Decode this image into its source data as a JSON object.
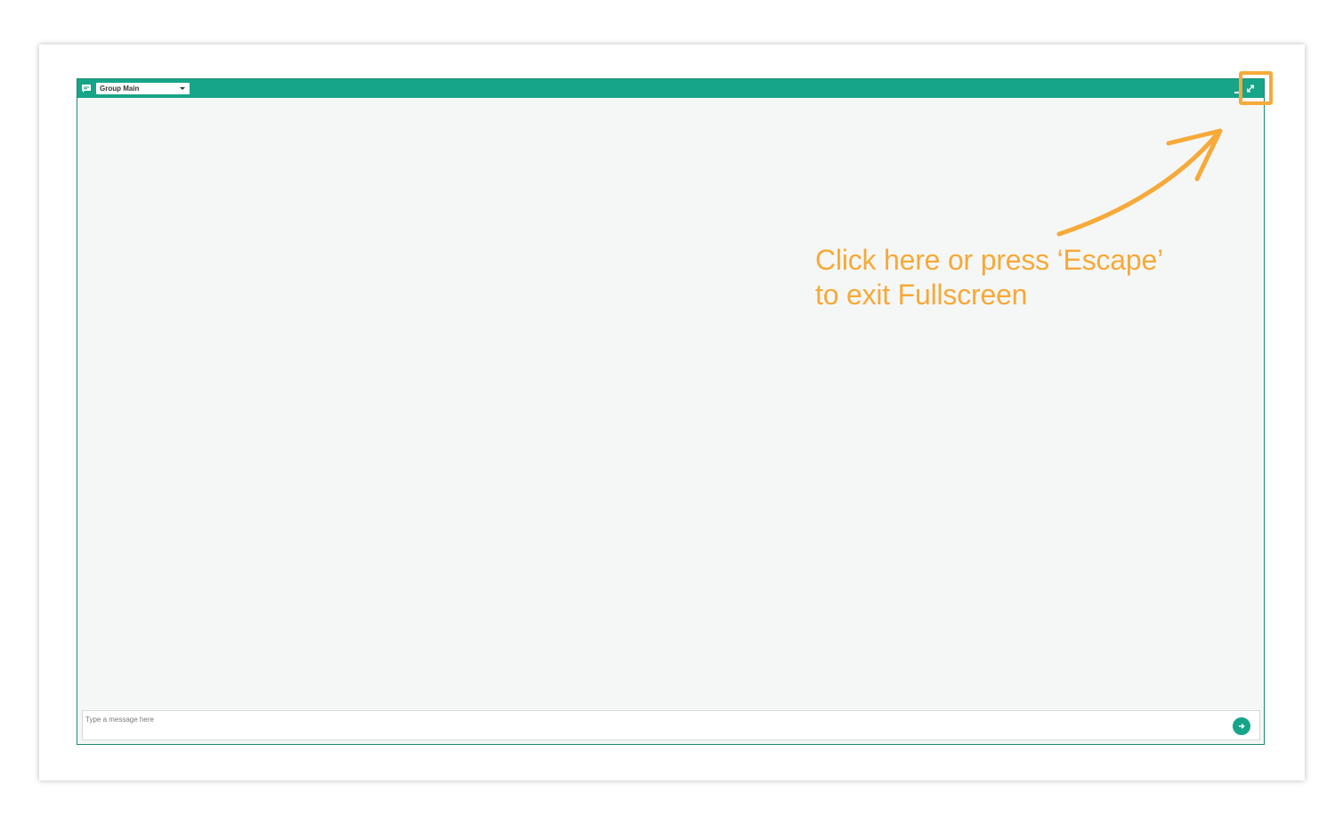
{
  "chat": {
    "group_select_value": "Group Main",
    "composer_placeholder": "Type a message here",
    "colors": {
      "header": "#17a589",
      "body_background": "#f5f7f6",
      "send_button": "#17a589"
    },
    "icons": {
      "header": "chat-bubble-icon",
      "dropdown": "caret-down-icon",
      "minimize": "minimize-icon",
      "fullscreen": "fullscreen-toggle-icon",
      "send": "send-arrow-icon"
    }
  },
  "annotation": {
    "line1": "Click here or press ‘Escape’",
    "line2": "to exit Fullscreen",
    "color": "#f7a939"
  }
}
